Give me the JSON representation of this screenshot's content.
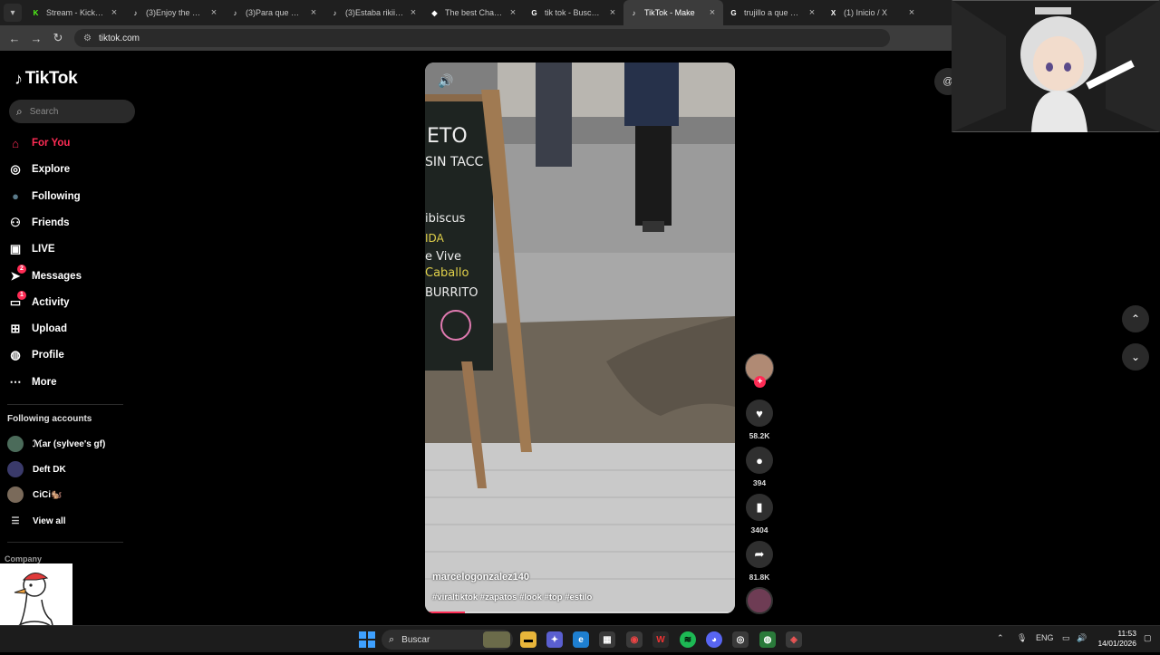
{
  "browser": {
    "tabs": [
      {
        "title": "Stream - Kick Das",
        "icon": "kick-icon",
        "color": "#53fc18"
      },
      {
        "title": "(3)Enjoy the Fun",
        "icon": "tiktok-icon",
        "color": "#ffffff"
      },
      {
        "title": "(3)Para que más",
        "icon": "tiktok-icon",
        "color": "#ffffff"
      },
      {
        "title": "(3)Estaba rikiiii😋",
        "icon": "tiktok-icon",
        "color": "#ffffff"
      },
      {
        "title": "The best ChatBot",
        "icon": "chatbot-icon",
        "color": "#ffffff"
      },
      {
        "title": "tik tok - Buscar co",
        "icon": "google-icon",
        "color": "#ffffff"
      },
      {
        "title": "TikTok - Make",
        "icon": "tiktok-icon",
        "color": "#ffffff",
        "active": true
      },
      {
        "title": "trujillo a que dep",
        "icon": "google-icon",
        "color": "#ffffff"
      },
      {
        "title": "(1) Inicio / X",
        "icon": "x-icon",
        "color": "#ffffff"
      }
    ],
    "url": "tiktok.com"
  },
  "sidebar": {
    "brand": "TikTok",
    "search_placeholder": "Search",
    "nav": [
      {
        "label": "For You",
        "icon": "home-icon",
        "active": true
      },
      {
        "label": "Explore",
        "icon": "compass-icon"
      },
      {
        "label": "Following",
        "icon": "following-avatar-icon"
      },
      {
        "label": "Friends",
        "icon": "friends-icon"
      },
      {
        "label": "LIVE",
        "icon": "live-icon"
      },
      {
        "label": "Messages",
        "icon": "messages-icon",
        "badge": "2"
      },
      {
        "label": "Activity",
        "icon": "activity-icon",
        "badge": "1"
      },
      {
        "label": "Upload",
        "icon": "upload-icon"
      },
      {
        "label": "Profile",
        "icon": "profile-icon"
      },
      {
        "label": "More",
        "icon": "more-icon"
      }
    ],
    "following_title": "Following accounts",
    "following": [
      {
        "name": "ℳar (sylvee's gf)"
      },
      {
        "name": "Deft DK"
      },
      {
        "name": "CiCi🐿️"
      }
    ],
    "view_all": "View all",
    "company": "Company"
  },
  "video": {
    "username": "marcelogonzalez140",
    "hashtags": "#viraltiktok #zapatos #look #top #estilo",
    "progress_percent": 13
  },
  "actions": {
    "likes": "58.2K",
    "comments": "394",
    "saves": "3404",
    "shares": "81.8K"
  },
  "taskbar": {
    "search_label": "Buscar",
    "language": "ENG",
    "time": "11:53",
    "date": "14/01/2026"
  }
}
